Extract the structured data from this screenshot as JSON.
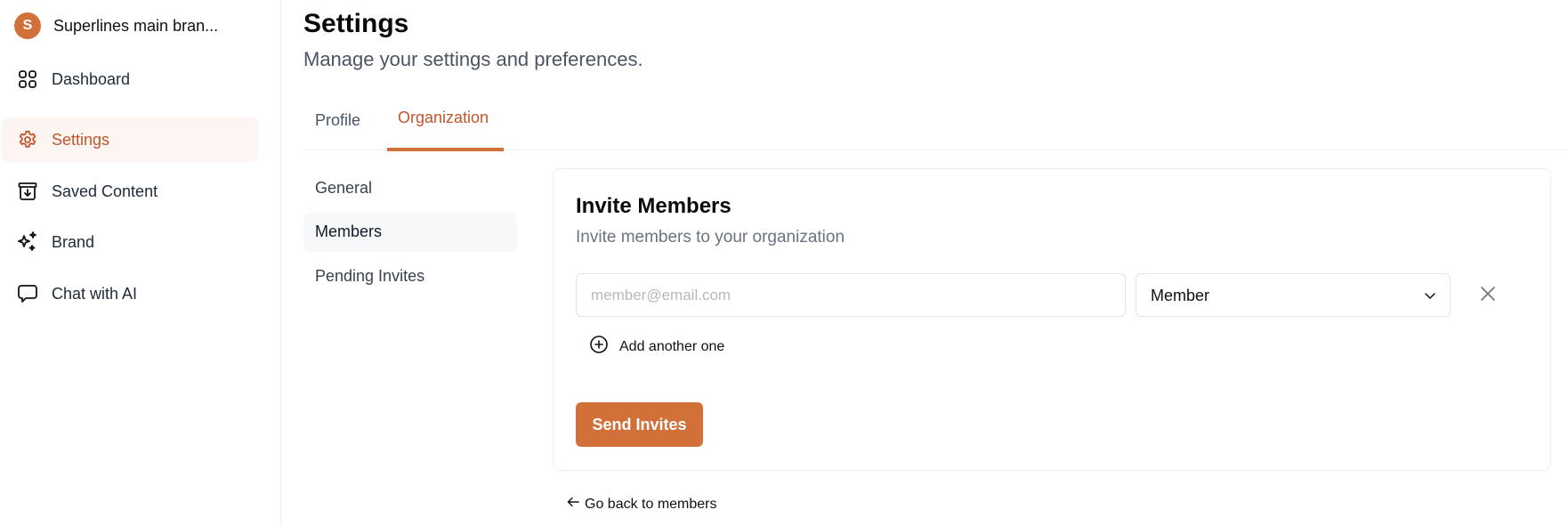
{
  "sidebar": {
    "org": {
      "initial": "S",
      "name": "Superlines main bran..."
    },
    "items": [
      {
        "label": "Dashboard",
        "icon": "grid-icon",
        "active": false
      },
      {
        "label": "Settings",
        "icon": "gear-icon",
        "active": true
      },
      {
        "label": "Saved Content",
        "icon": "archive-download-icon",
        "active": false
      },
      {
        "label": "Brand",
        "icon": "sparkles-icon",
        "active": false
      },
      {
        "label": "Chat with AI",
        "icon": "chat-bubble-icon",
        "active": false
      }
    ]
  },
  "header": {
    "title": "Settings",
    "subtitle": "Manage your settings and preferences."
  },
  "tabs": [
    {
      "label": "Profile",
      "active": false
    },
    {
      "label": "Organization",
      "active": true
    }
  ],
  "subnav": [
    {
      "label": "General",
      "active": false
    },
    {
      "label": "Members",
      "active": true
    },
    {
      "label": "Pending Invites",
      "active": false
    }
  ],
  "invite": {
    "title": "Invite Members",
    "subtitle": "Invite members to your organization",
    "email_value": "",
    "email_placeholder": "member@email.com",
    "role_value": "Member",
    "add_label": "Add another one",
    "send_label": "Send Invites",
    "back_label": "Go back to members"
  },
  "colors": {
    "accent": "#d2703a",
    "accent_text": "#c2552b",
    "active_bg": "#fdf5f1"
  }
}
